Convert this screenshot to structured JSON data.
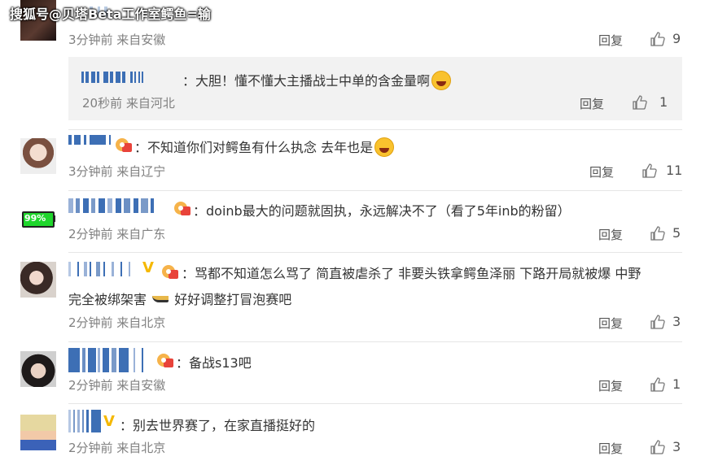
{
  "watermark": "搜狐号@贝塔Beta工作室鳄鱼=输",
  "comments": [
    {
      "meta": "3分钟前 来自安徽",
      "reply": "回复",
      "likes": "9",
      "sub_reply": {
        "text": "：大胆！懂不懂大主播战士中单的含金量啊",
        "meta": "20秒前 来自河北",
        "reply": "回复",
        "likes": "1"
      }
    },
    {
      "text": "：不知道你们对鳄鱼有什么执念 去年也是",
      "meta": "3分钟前 来自辽宁",
      "reply": "回复",
      "likes": "11"
    },
    {
      "avatar_text": "99%",
      "text": "：doinb最大的问题就固执，永远解决不了（看了5年inb的粉留）",
      "meta": "2分钟前 来自广东",
      "reply": "回复",
      "likes": "5"
    },
    {
      "text": "：骂都不知道怎么骂了 简直被虐杀了 非要头铁拿鳄鱼泽丽 下路开局就被爆 中野",
      "text2": "完全被绑架害",
      "text3": "好好调整打冒泡赛吧",
      "meta": "2分钟前 来自北京",
      "reply": "回复",
      "likes": "3"
    },
    {
      "text": "：备战s13吧",
      "meta": "2分钟前 来自安徽",
      "reply": "回复",
      "likes": "1"
    },
    {
      "text": "：别去世界赛了，在家直播挺好的",
      "meta": "2分钟前 来自北京",
      "reply": "回复",
      "likes": "3"
    }
  ],
  "colors": {
    "username_blue": "#3d6fb5",
    "meta_gray": "#808080",
    "vip_gold": "#f5b800"
  },
  "icons": {
    "like": "thumbs-up-icon",
    "badge": "fan-badge-icon"
  }
}
